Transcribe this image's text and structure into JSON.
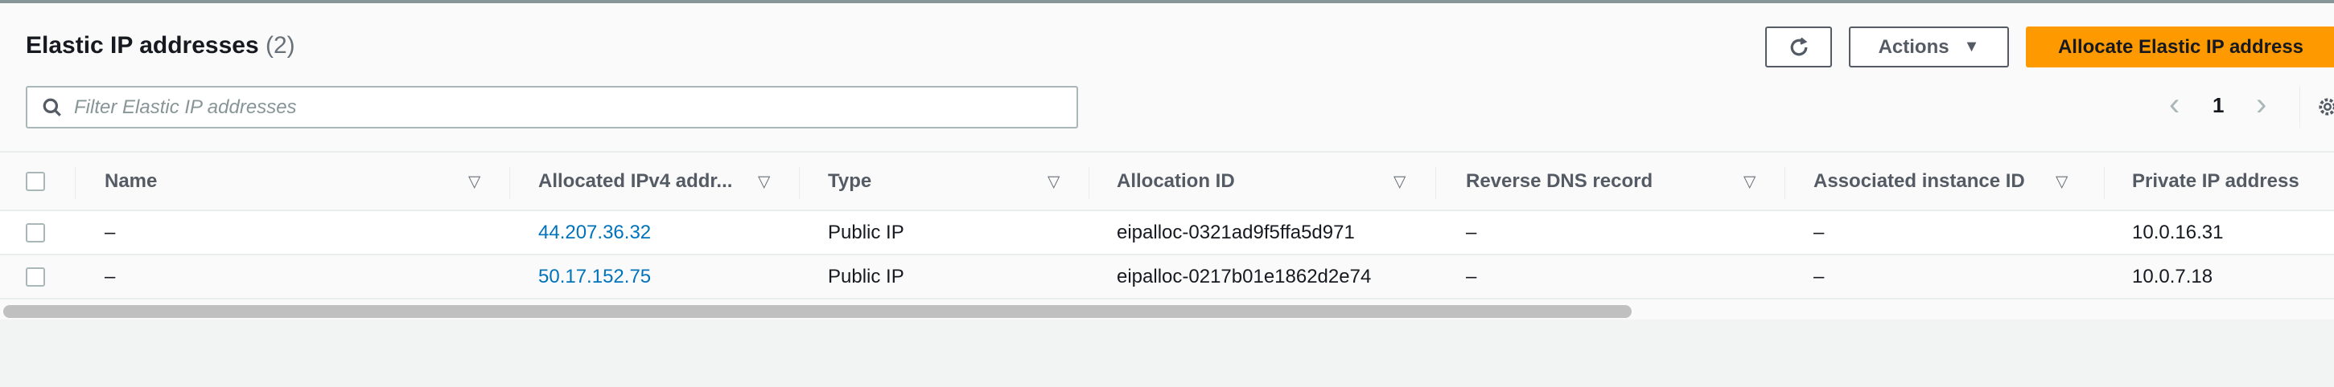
{
  "header": {
    "title": "Elastic IP addresses",
    "count": "(2)"
  },
  "toolbar": {
    "refresh_icon": "refresh-icon",
    "actions_label": "Actions",
    "actions_caret": "▼",
    "allocate_label": "Allocate Elastic IP address"
  },
  "search": {
    "placeholder": "Filter Elastic IP addresses",
    "value": ""
  },
  "pagination": {
    "prev": "‹",
    "page": "1",
    "next": "›"
  },
  "table": {
    "columns": [
      "Name",
      "Allocated IPv4 addr...",
      "Type",
      "Allocation ID",
      "Reverse DNS record",
      "Associated instance ID",
      "Private IP address"
    ],
    "rows": [
      [
        "–",
        "44.207.36.32",
        "Public IP",
        "eipalloc-0321ad9f5ffa5d971",
        "–",
        "–",
        "10.0.16.31"
      ],
      [
        "–",
        "50.17.152.75",
        "Public IP",
        "eipalloc-0217b01e1862d2e74",
        "–",
        "–",
        "10.0.7.18"
      ]
    ]
  },
  "colors": {
    "primary": "#ff9900",
    "link": "#0073bb"
  }
}
